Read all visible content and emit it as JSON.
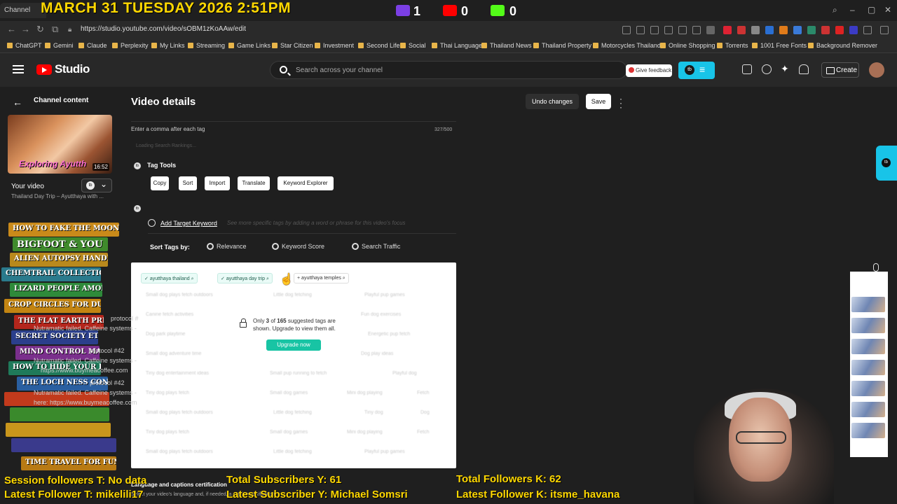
{
  "overlay": {
    "date": "MARCH 31 TUESDAY 2026 2:51PM",
    "twitch_count": "1",
    "youtube_count": "0",
    "kick_count": "0",
    "session_followers": "Session followers T: No data",
    "latest_follower_t": "Latest Follower T: mikelili17",
    "total_subscribers": "Total Subscribers Y: 61",
    "latest_subscriber": "Latest Subscriber Y: Michael Somsri",
    "total_followers_k": "Total Followers K: 62",
    "latest_follower_k": "Latest Follower K: itsme_havana"
  },
  "browser": {
    "tabs": [
      "Channel"
    ],
    "url": "https://studio.youtube.com/video/sOBM1zKoAAw/edit",
    "bookmarks": [
      "ChatGPT",
      "Gemini",
      "Claude",
      "Perplexity",
      "My Links",
      "Streaming",
      "Game Links",
      "Star Citizen",
      "Investment",
      "Second Life",
      "Social",
      "Thai Language",
      "Thailand News",
      "Thailand Property",
      "Motorcycles Thailand",
      "Online Shopping",
      "Torrents",
      "1001 Free Fonts",
      "Background Remover"
    ]
  },
  "header": {
    "studio_label": "Studio",
    "search_placeholder": "Search across your channel",
    "feedback_label": "Give feedback",
    "create_label": "Create"
  },
  "sidebar": {
    "channel_content": "Channel content",
    "thumb_title": "Exploring Ayutth",
    "thumb_duration": "16:52",
    "your_video": "Your video",
    "video_subtitle": "Thailand Day Trip – Ayutthaya with ..."
  },
  "main": {
    "page_title": "Video details",
    "undo_label": "Undo changes",
    "save_label": "Save",
    "hint": "Enter a comma after each tag",
    "count": "327/500",
    "loading": "Loading Search Rankings...",
    "tag_tools_title": "Tag Tools",
    "tag_tools_buttons": [
      "Copy",
      "Sort",
      "Import",
      "Translate",
      "Keyword Explorer"
    ],
    "add_target_label": "Add Target Keyword",
    "add_target_hint": "See more specific tags by adding a word or phrase for this video's focus",
    "sort_by_label": "Sort Tags by:",
    "sort_options": [
      "Relevance",
      "Keyword Score",
      "Search Traffic"
    ],
    "chips": [
      "ayutthaya thailand",
      "ayutthaya day trip",
      "ayutthaya temples"
    ],
    "upsell_prefix": "Only ",
    "upsell_shown": "3",
    "upsell_middle": " of ",
    "upsell_total": "165",
    "upsell_suffix": " suggested tags are shown. Upgrade to view them all.",
    "upgrade_label": "Upgrade now",
    "blurred_tags": [
      "Small dog plays fetch outdoors",
      "Little dog fetching",
      "Playful pup games",
      "Canine fetch activities",
      "Fun dog exercises",
      "Dog park playtime",
      "Energetic pup fetch",
      "Small dog adventure time",
      "Dog play ideas",
      "Tiny dog entertainment ideas",
      "Small pup running to fetch",
      "Playful dog",
      "Tiny dog plays fetch",
      "Small dog games",
      "Mini dog playing",
      "Fetch",
      "Small dog plays fetch outdoors",
      "Little dog fetching",
      "Tiny dog",
      "Dog",
      "Tiny dog plays fetch",
      "Small dog games",
      "Mini dog playing",
      "Fetch",
      "Small dog plays fetch outdoors",
      "Little dog fetching",
      "Playful pup games"
    ],
    "lang_title": "Language and captions certification",
    "lang_sub": "Select your video's language and, if needed, a caption certification"
  },
  "books": [
    {
      "title": "HOW TO FAKE THE MOON LANDING",
      "color": "#c98a1a"
    },
    {
      "title": "BIGFOOT & YOU",
      "color": "#3f8a2c"
    },
    {
      "title": "ALIEN AUTOPSY HANDBOOK",
      "color": "#b8891d"
    },
    {
      "title": "CHEMTRAIL COLLECTION GUIDE",
      "color": "#2a7a8c"
    },
    {
      "title": "LIZARD PEOPLE AMONG US",
      "color": "#2e8a3a"
    },
    {
      "title": "CROP CIRCLES FOR DUMMIES",
      "color": "#c28412"
    },
    {
      "title": "THE FLAT EARTH PRIMER",
      "color": "#b4261c"
    },
    {
      "title": "SECRET SOCIETY ETIQUETTE",
      "color": "#2b3f8c"
    },
    {
      "title": "MIND CONTROL MADE EASY",
      "color": "#7a2f8c"
    },
    {
      "title": "HOW TO HIDE YOUR BUNKER",
      "color": "#1f7a5a"
    },
    {
      "title": "THE LOCH NESS CONSPIRACY",
      "color": "#2a5fa0"
    },
    {
      "title": "",
      "color": "#c23a1c"
    },
    {
      "title": "",
      "color": "#3a8a2c"
    },
    {
      "title": "",
      "color": "#c9961c"
    },
    {
      "title": "",
      "color": "#3a3a8c"
    },
    {
      "title": "TIME TRAVEL FOR FUN & PROFIT",
      "color": "#b87a14"
    }
  ],
  "chat_lines": [
    "protocol #",
    "Nutramatic failed. Caffeine systems -",
    "protocol #42",
    "Nutramatic failed. Caffeine systems -",
    "https://www.buymeacoffee.com",
    "protocol #42",
    "Nutramatic failed. Caffeine systems -",
    "here: https://www.buymeacoffee.com"
  ]
}
